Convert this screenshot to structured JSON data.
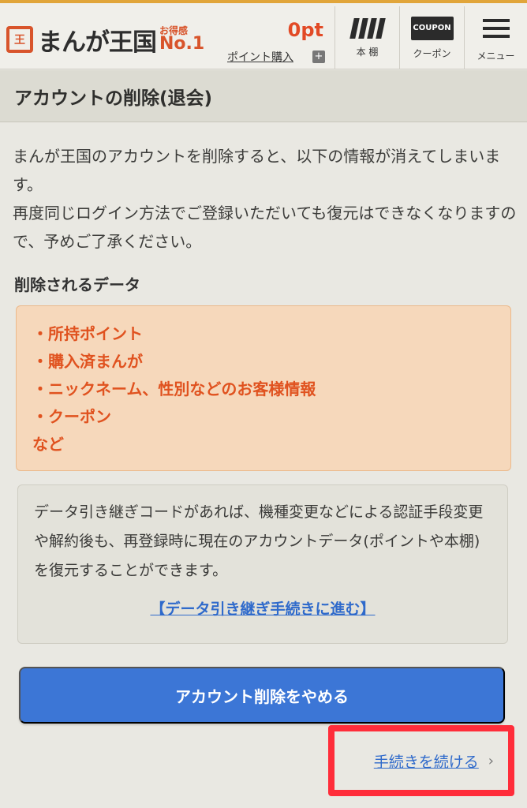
{
  "header": {
    "logo_mark": "王",
    "logo_text": "まんが王国",
    "logo_badge_small": "お得感",
    "logo_badge_big": "No.1",
    "points_value": "0pt",
    "points_buy_label": "ポイント購入",
    "points_plus": "+",
    "nav": [
      {
        "label": "本 棚",
        "icon": "bookshelf-icon"
      },
      {
        "label": "クーポン",
        "icon": "coupon-icon",
        "icon_text": "COUPON"
      },
      {
        "label": "メニュー",
        "icon": "menu-icon"
      }
    ]
  },
  "page": {
    "title": "アカウントの削除(退会)",
    "intro_line1": "まんが王国のアカウントを削除すると、以下の情報が消えてしまいます。",
    "intro_line2": "再度同じログイン方法でご登録いただいても復元はできなくなりますので、予めご了承ください。",
    "deleted_data_title": "削除されるデータ",
    "deleted_items": [
      "・所持ポイント",
      "・購入済まんが",
      "・ニックネーム、性別などのお客様情報",
      "・クーポン",
      "など"
    ],
    "transfer_note": "データ引き継ぎコードがあれば、機種変更などによる認証手段変更や解約後も、再登録時に現在のアカウントデータ(ポイントや本棚)を復元することができます。",
    "transfer_link": "【データ引き継ぎ手続きに進む】",
    "cancel_button": "アカウント削除をやめる",
    "continue_link": "手続きを続ける",
    "continue_chevron": "›"
  },
  "colors": {
    "accent_orange": "#e0521f",
    "link_blue": "#2f6acb",
    "button_blue": "#3c76d6",
    "highlight_red": "#ff2d3a"
  }
}
